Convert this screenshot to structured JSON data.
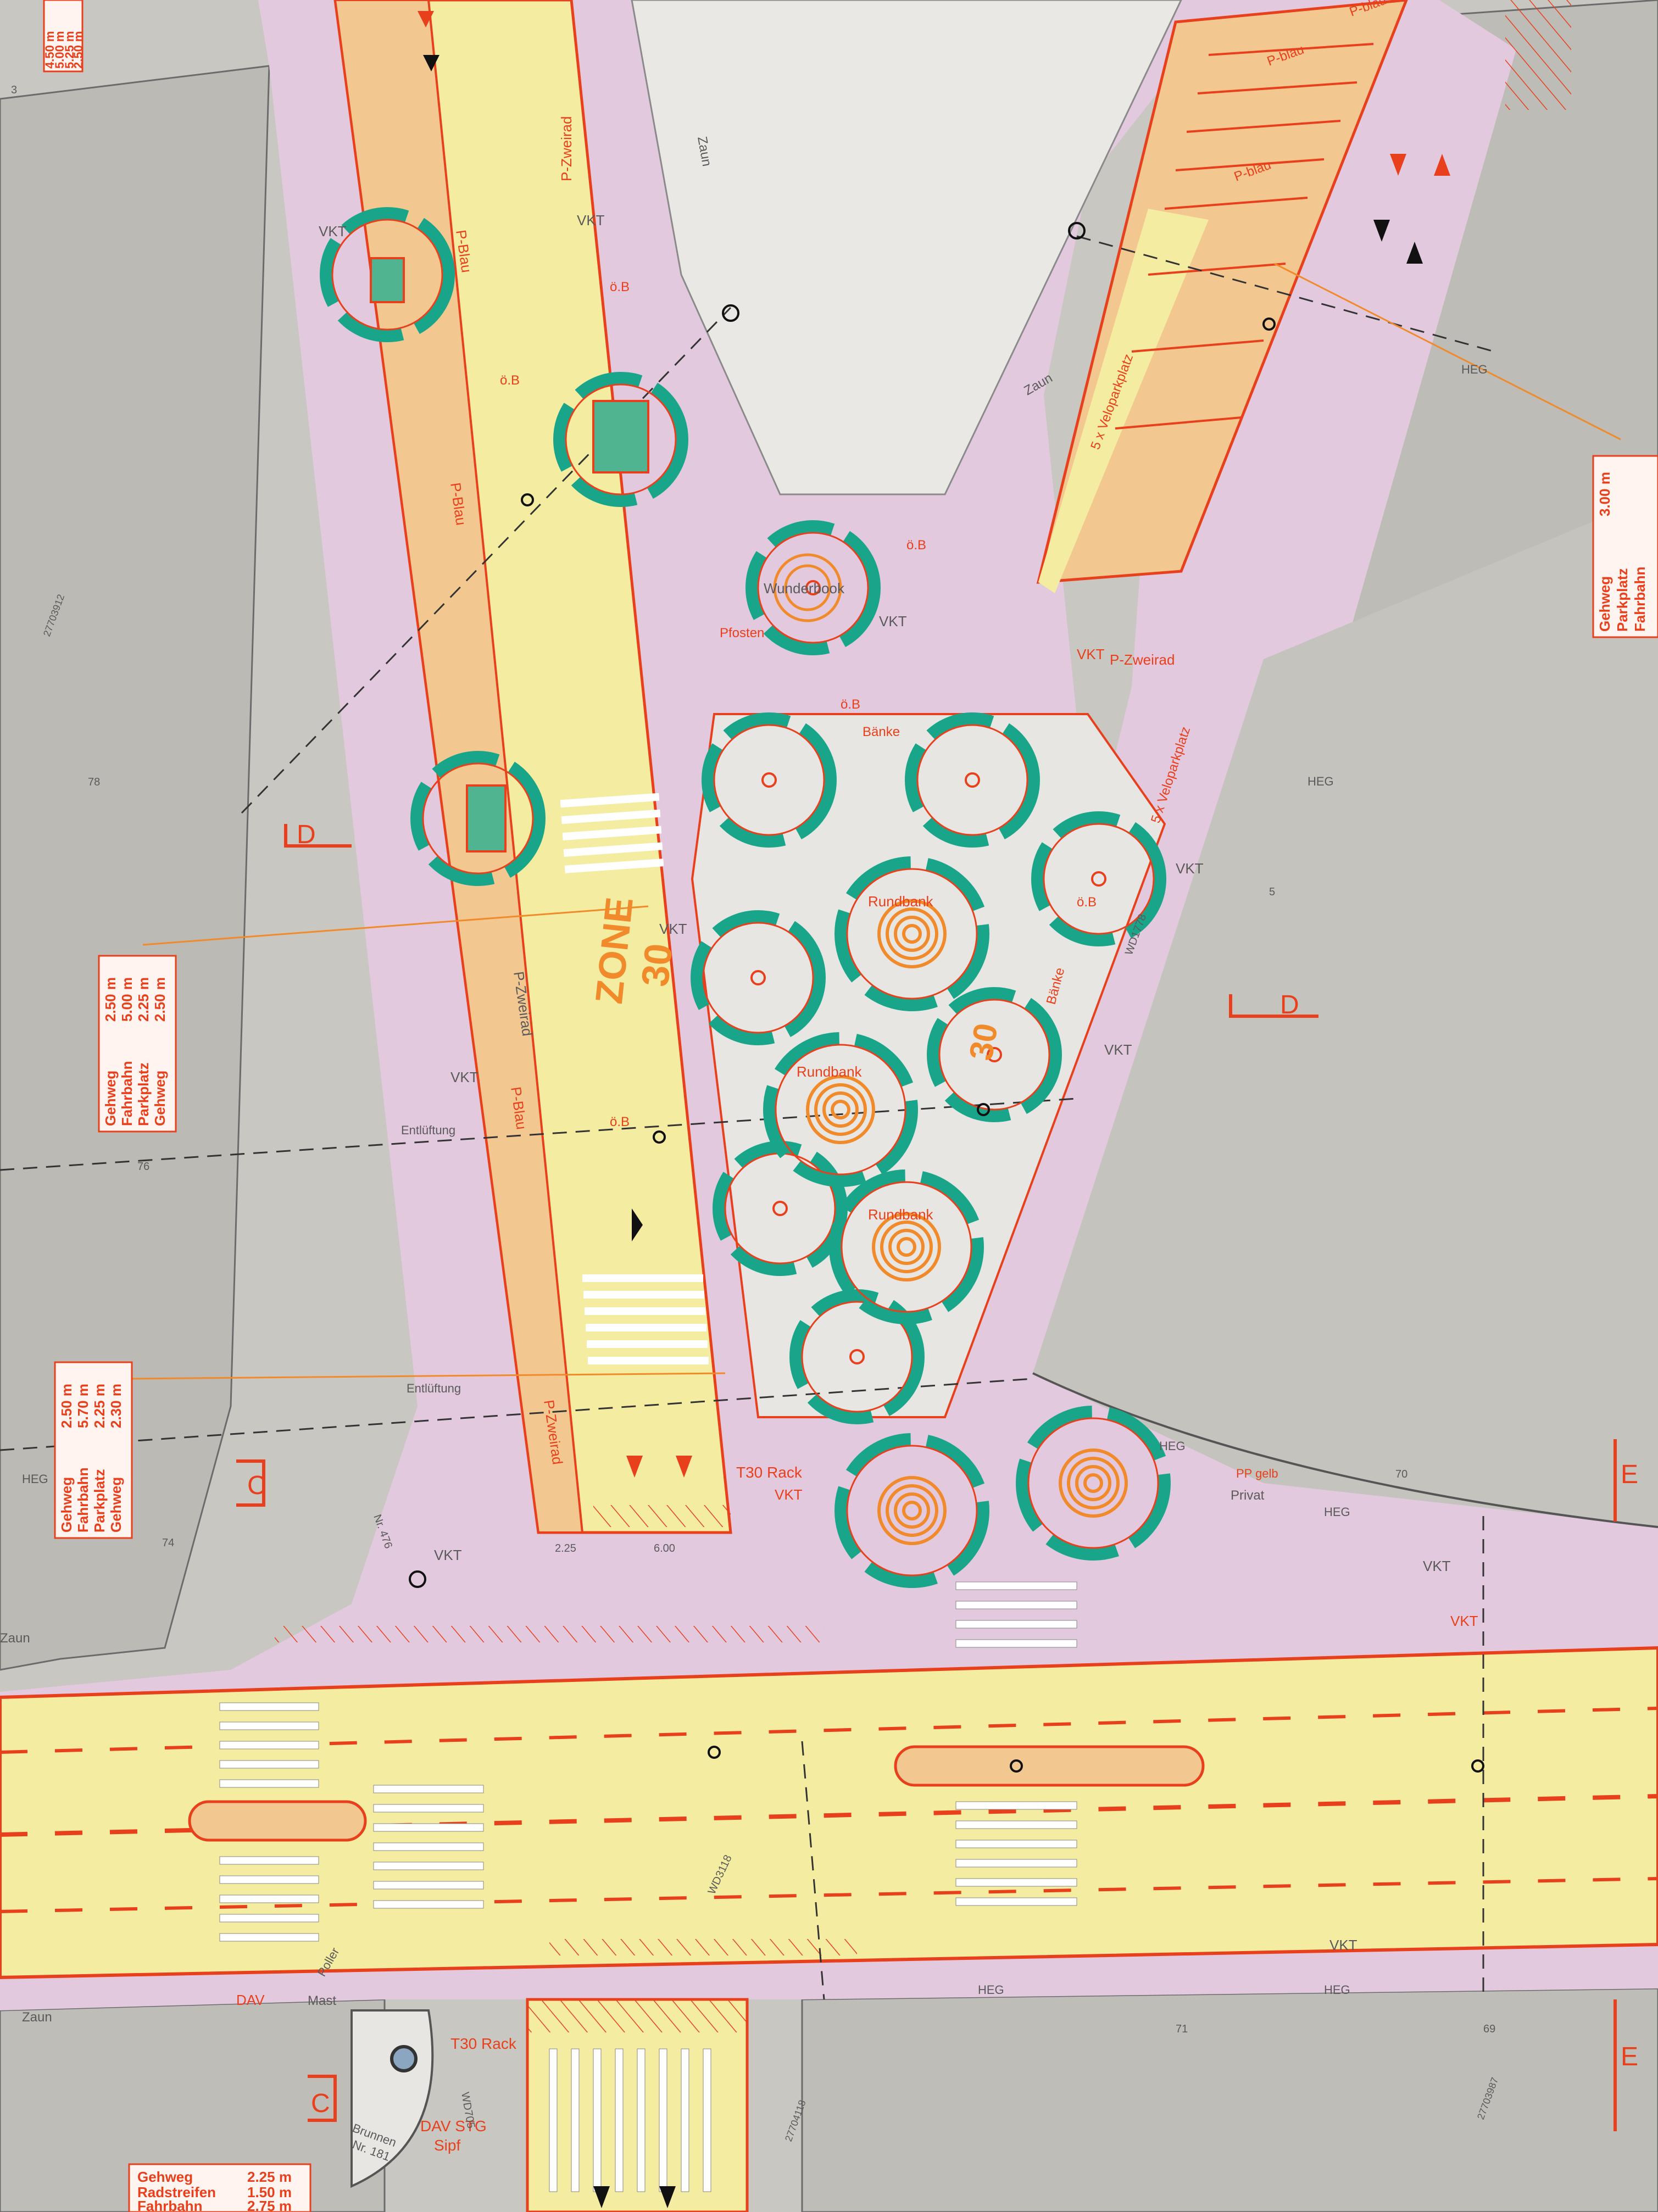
{
  "colors": {
    "paper": "#c9c7c2",
    "building": "#b9b8b3",
    "sidewalk": "#e2c8dd",
    "roadway": "#f4eca0",
    "parking": "#f3c890",
    "plaza": "#e6e5e1",
    "tree_ring": "#19a58a",
    "red": "#e8401c",
    "orange": "#f08a2a"
  },
  "section_markers": [
    {
      "letter": "D",
      "id": "d-left"
    },
    {
      "letter": "D",
      "id": "d-right"
    },
    {
      "letter": "C",
      "id": "c-mid"
    },
    {
      "letter": "C",
      "id": "c-bottom"
    },
    {
      "letter": "E",
      "id": "e-mid"
    },
    {
      "letter": "E",
      "id": "e-bottom"
    }
  ],
  "cross_section_tables": [
    {
      "id": "top-left",
      "rows": [
        [
          "",
          "4.50 m"
        ],
        [
          "",
          "5.00 m"
        ],
        [
          "",
          "5.25 m"
        ],
        [
          "",
          "2.50 m"
        ]
      ]
    },
    {
      "id": "mid-left",
      "rows": [
        [
          "Gehweg",
          "2.50 m"
        ],
        [
          "Fahrbahn",
          "5.00 m"
        ],
        [
          "Parkplatz",
          "2.25 m"
        ],
        [
          "Gehweg",
          "2.50 m"
        ]
      ]
    },
    {
      "id": "lower-left",
      "rows": [
        [
          "Gehweg",
          "2.50 m"
        ],
        [
          "Fahrbahn",
          "5.70 m"
        ],
        [
          "Parkplatz",
          "2.25 m"
        ],
        [
          "Gehweg",
          "2.30 m"
        ]
      ]
    },
    {
      "id": "bottom-left",
      "rows": [
        [
          "Gehweg",
          "2.25 m"
        ],
        [
          "Radstreifen",
          "1.50 m"
        ],
        [
          "Fahrbahn",
          "2.75 m"
        ]
      ]
    },
    {
      "id": "right",
      "rows": [
        [
          "Gehweg",
          "3.00 m"
        ],
        [
          "Parkplatz",
          ""
        ],
        [
          "Fahrbahn",
          ""
        ]
      ]
    }
  ],
  "labels": {
    "zone_line1": "ZONE",
    "zone_line2": "30",
    "zone_small": "30",
    "p_blau": "P-Blau",
    "p_zweirad": "P-Zweirad",
    "p_blau_lower": "P-blau",
    "vkt": "VKT",
    "heg": "HEG",
    "ob": "ö.B",
    "zaun": "Zaun",
    "poller": "Poller",
    "mast": "Mast",
    "privat": "Privat",
    "pfosten": "Pfosten",
    "wunderbook": "Wunderbook",
    "rundbank": "Rundbank",
    "baenke": "Bänke",
    "veloparkplatz": "5 x Veloparkplatz",
    "t30_rack": "T30 Rack",
    "entlueftung": "Entlüftung",
    "dav": "DAV",
    "dav_stg": "DAV STG",
    "sipf": "Sipf",
    "brunnen": "Brunnen",
    "nr181": "Nr. 181",
    "nr476": "Nr. 476",
    "wd1778": "WD1778",
    "wd3118": "WD3118",
    "wd705": "WD705",
    "dim_225": "2.25",
    "dim_600": "6.00",
    "pp_gelb": "PP gelb"
  },
  "parcel_numbers": [
    "78",
    "76",
    "74",
    "70",
    "71",
    "69",
    "5",
    "3",
    "27703912",
    "27704118",
    "27703987"
  ]
}
